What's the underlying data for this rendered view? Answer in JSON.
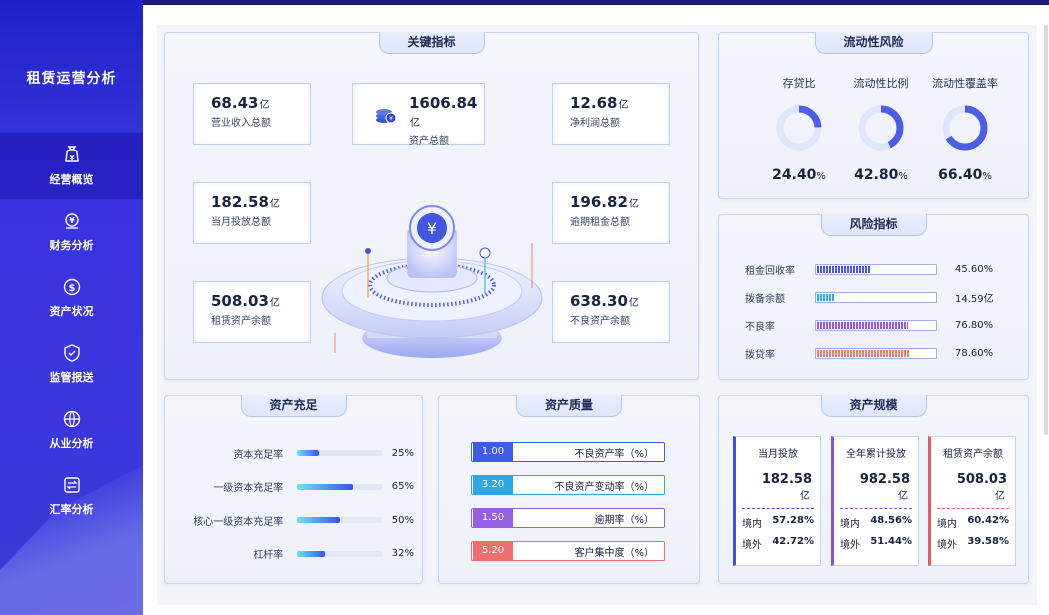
{
  "sidebar": {
    "title": "租赁运营分析",
    "items": [
      {
        "label": "经营概览",
        "icon": "money-bag-icon",
        "active": true
      },
      {
        "label": "财务分析",
        "icon": "finance-icon",
        "active": false
      },
      {
        "label": "资产状况",
        "icon": "dollar-icon",
        "active": false
      },
      {
        "label": "监管报送",
        "icon": "shield-icon",
        "active": false
      },
      {
        "label": "从业分析",
        "icon": "globe-icon",
        "active": false
      },
      {
        "label": "汇率分析",
        "icon": "exchange-icon",
        "active": false
      }
    ]
  },
  "key_metrics": {
    "title": "关键指标",
    "unit": "亿",
    "items": [
      {
        "value": "68.43",
        "label": "营业收入总额"
      },
      {
        "value": "1606.84",
        "label": "资产总额"
      },
      {
        "value": "12.68",
        "label": "净利润总额"
      },
      {
        "value": "182.58",
        "label": "当月投放总额"
      },
      {
        "value": "196.82",
        "label": "逾期租金总额"
      },
      {
        "value": "508.03",
        "label": "租赁资产余额"
      },
      {
        "value": "638.30",
        "label": "不良资产余额"
      }
    ]
  },
  "liquidity": {
    "title": "流动性风险",
    "items": [
      {
        "name": "存贷比",
        "value": "24.40",
        "unit": "%",
        "fraction": 0.244
      },
      {
        "name": "流动性比例",
        "value": "42.80",
        "unit": "%",
        "fraction": 0.428
      },
      {
        "name": "流动性覆盖率",
        "value": "66.40",
        "unit": "%",
        "fraction": 0.664
      }
    ]
  },
  "risk": {
    "title": "风险指标",
    "items": [
      {
        "label": "租金回收率",
        "value": "45.60%",
        "fraction": 0.456,
        "color": "#4a55e0"
      },
      {
        "label": "拨备余额",
        "value": "14.59亿",
        "fraction": 0.146,
        "color": "#3aa3ee"
      },
      {
        "label": "不良率",
        "value": "76.80%",
        "fraction": 0.768,
        "color": "#9b59e6"
      },
      {
        "label": "拨贷率",
        "value": "78.60%",
        "fraction": 0.786,
        "color": "#f07a7a"
      }
    ]
  },
  "capital": {
    "title": "资产充足",
    "items": [
      {
        "label": "资本充足率",
        "value": "25%",
        "fraction": 0.25
      },
      {
        "label": "一级资本充足率",
        "value": "65%",
        "fraction": 0.65
      },
      {
        "label": "核心一级资本充足率",
        "value": "50%",
        "fraction": 0.5
      },
      {
        "label": "杠杆率",
        "value": "32%",
        "fraction": 0.32
      }
    ]
  },
  "quality": {
    "title": "资产质量",
    "items": [
      {
        "tag": "1.00",
        "label": "不良资产率（%）",
        "color": "#3f5ce8"
      },
      {
        "tag": "3.20",
        "label": "不良资产变动率（%）",
        "color": "#2fa6e6"
      },
      {
        "tag": "1.50",
        "label": "逾期率（%）",
        "color": "#9460e0"
      },
      {
        "tag": "5.20",
        "label": "客户集中度（%）",
        "color": "#f06e6e"
      }
    ]
  },
  "scale": {
    "title": "资产规模",
    "unit": "亿",
    "domestic_label": "境内",
    "overseas_label": "境外",
    "cards": [
      {
        "title": "当月投放",
        "value": "182.58",
        "domestic": "57.28%",
        "overseas": "42.72%",
        "color": "#3f4fe0"
      },
      {
        "title": "全年累计投放",
        "value": "982.58",
        "domestic": "48.56%",
        "overseas": "51.44%",
        "color": "#8a4fe3"
      },
      {
        "title": "租赁资产余额",
        "value": "508.03",
        "domestic": "60.42%",
        "overseas": "39.58%",
        "color": "#e85a6a"
      }
    ]
  }
}
